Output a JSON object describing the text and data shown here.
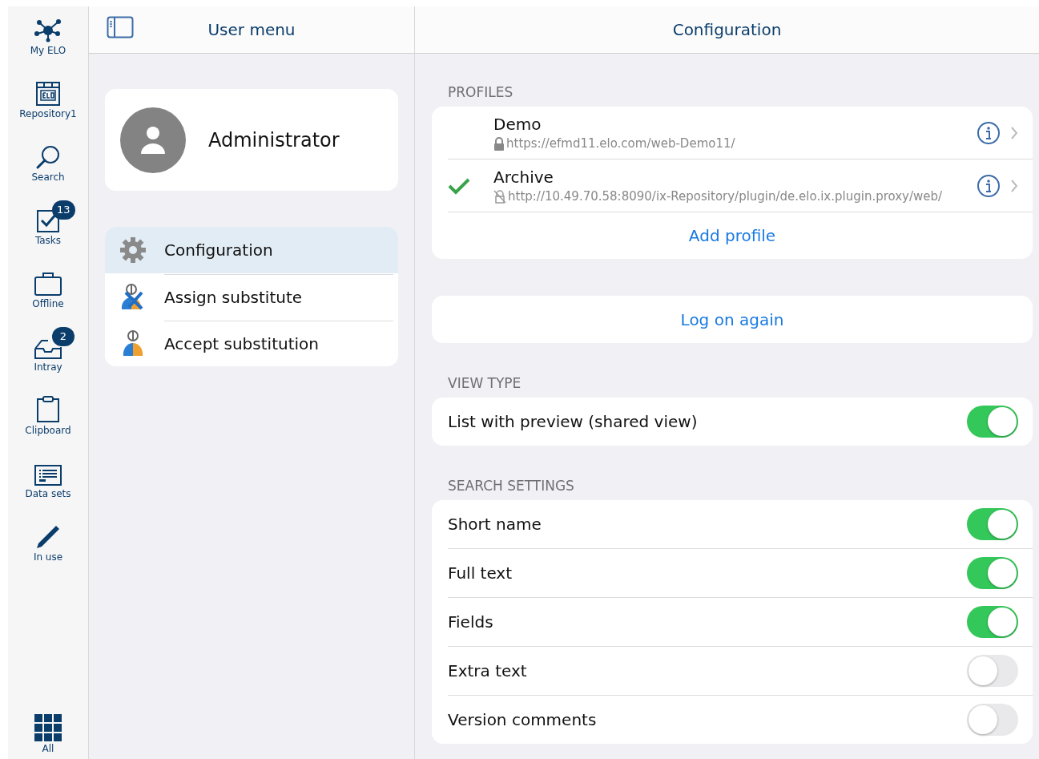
{
  "rail": {
    "items": [
      {
        "label": "My ELO",
        "kind": "network",
        "selected": false
      },
      {
        "label": "Repository1",
        "kind": "repository",
        "selected": false
      },
      {
        "label": "Search",
        "kind": "search",
        "selected": false
      },
      {
        "label": "Tasks",
        "kind": "tasks",
        "badge": "13",
        "selected": false
      },
      {
        "label": "Offline",
        "kind": "briefcase",
        "selected": false
      },
      {
        "label": "Intray",
        "kind": "tray",
        "badge": "2",
        "selected": false
      },
      {
        "label": "Clipboard",
        "kind": "clipboard",
        "selected": false
      },
      {
        "label": "Data sets",
        "kind": "form",
        "selected": false
      },
      {
        "label": "In use",
        "kind": "pen",
        "selected": false
      }
    ],
    "bottom": {
      "label": "All",
      "kind": "grid",
      "selected": false
    }
  },
  "user_menu": {
    "title": "User menu",
    "user": {
      "name": "Administrator"
    },
    "items": [
      {
        "label": "Configuration",
        "kind": "gear",
        "selected": true
      },
      {
        "label": "Assign substitute",
        "kind": "assign",
        "selected": false
      },
      {
        "label": "Accept substitution",
        "kind": "accept",
        "selected": false
      }
    ]
  },
  "configuration": {
    "title": "Configuration",
    "profiles": {
      "heading": "PROFILES",
      "items": [
        {
          "name": "Demo",
          "url": "https://efmd11.elo.com/web-Demo11/",
          "secure": true,
          "selected": false
        },
        {
          "name": "Archive",
          "url": "http://10.49.70.58:8090/ix-Repository/plugin/de.elo.ix.plugin.proxy/web/",
          "secure": false,
          "selected": true
        }
      ],
      "add_label": "Add profile"
    },
    "log_on_again": "Log on again",
    "view_type": {
      "heading": "VIEW TYPE",
      "items": [
        {
          "label": "List with preview (shared view)",
          "on": true
        }
      ]
    },
    "search_settings": {
      "heading": "SEARCH SETTINGS",
      "items": [
        {
          "label": "Short name",
          "on": true
        },
        {
          "label": "Full text",
          "on": true
        },
        {
          "label": "Fields",
          "on": true
        },
        {
          "label": "Extra text",
          "on": false
        },
        {
          "label": "Version comments",
          "on": false
        }
      ]
    }
  }
}
